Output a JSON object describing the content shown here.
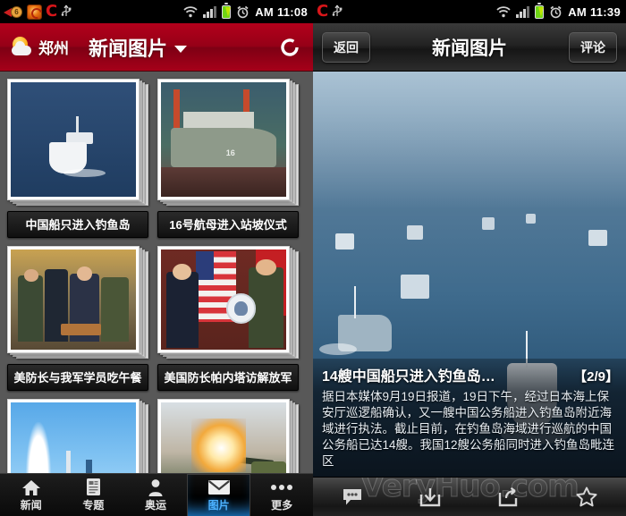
{
  "left_phone": {
    "statusbar": {
      "notification_badge": "6",
      "icons": [
        "notification-arrow-icon",
        "weibo-app-icon",
        "changba-c-icon",
        "usb-icon",
        "wifi-icon",
        "signal-icon",
        "battery-icon",
        "alarm-icon"
      ],
      "time": "AM 11:08"
    },
    "header": {
      "weather_icon": "sun-cloud-icon",
      "city": "郑州",
      "title": "新闻图片",
      "dropdown_icon": "chevron-down-icon",
      "refresh_icon": "refresh-icon"
    },
    "gallery": {
      "rows": [
        [
          {
            "caption": "中国船只进入钓鱼岛",
            "art": "art-ship-sea"
          },
          {
            "caption": "16号航母进入站坡仪式",
            "art": "art-carrier"
          }
        ],
        [
          {
            "caption": "美防长与我军学员吃午餐",
            "art": "art-lunch"
          },
          {
            "caption": "美国防长帕内塔访解放军",
            "art": "art-flags"
          }
        ],
        [
          {
            "caption": "",
            "art": "art-launch"
          },
          {
            "caption": "",
            "art": "art-fire"
          }
        ]
      ]
    },
    "tabbar": {
      "tabs": [
        {
          "label": "新闻",
          "icon": "home-icon",
          "active": false
        },
        {
          "label": "专题",
          "icon": "document-icon",
          "active": false
        },
        {
          "label": "奥运",
          "icon": "person-icon",
          "active": false
        },
        {
          "label": "图片",
          "icon": "envelope-icon",
          "active": true
        },
        {
          "label": "更多",
          "icon": "more-dots-icon",
          "active": false
        }
      ],
      "active_color": "#4db2ff"
    }
  },
  "right_phone": {
    "statusbar": {
      "icons": [
        "changba-c-icon",
        "usb-icon",
        "wifi-icon",
        "signal-icon",
        "battery-icon",
        "alarm-icon"
      ],
      "time": "AM 11:39"
    },
    "header": {
      "back_label": "返回",
      "title": "新闻图片",
      "comment_label": "评论"
    },
    "viewer": {
      "photo_alt": "ships-at-sea-photo",
      "caption_title": "14艘中国船只进入钓鱼岛…",
      "caption_index": "【2/9】",
      "caption_body": "据日本媒体9月19日报道，19日下午，经过日本海上保安厅巡逻船确认，又一艘中国公务船进入钓鱼岛附近海域进行执法。截止目前，在钓鱼岛海域进行巡航的中国公务船已达14艘。我国12艘公务船同时进入钓鱼岛毗连区"
    },
    "toolbar": {
      "items": [
        {
          "icon": "comment-icon"
        },
        {
          "icon": "download-icon"
        },
        {
          "icon": "share-icon"
        },
        {
          "icon": "star-icon"
        }
      ],
      "watermark": "VeryHuo.com"
    }
  }
}
